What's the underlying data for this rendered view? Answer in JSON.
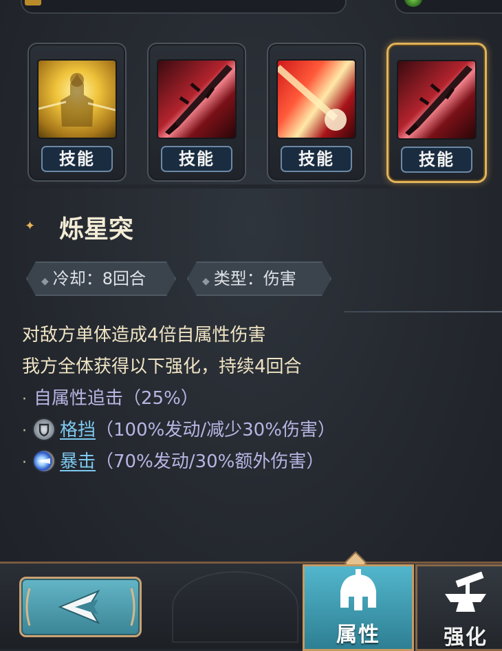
{
  "skills": [
    {
      "art": "golden-knight-skill-art",
      "tag": "技能",
      "selected": false
    },
    {
      "art": "crimson-sword-skill-art",
      "tag": "技能",
      "selected": false
    },
    {
      "art": "red-beam-skill-art",
      "tag": "技能",
      "selected": false
    },
    {
      "art": "crimson-sword-skill-art",
      "tag": "技能",
      "selected": true
    }
  ],
  "skill_detail": {
    "name": "烁星突",
    "cooldown": "冷却：8回合",
    "type": "类型：伤害",
    "description": [
      "对敌方单体造成4倍自属性伤害",
      "我方全体获得以下强化，持续4回合"
    ],
    "buffs": {
      "chase": {
        "text": "自属性追击（25%）"
      },
      "block": {
        "icon": "shield-icon",
        "link": "格挡",
        "detail": "（100%发动/减少30%伤害）"
      },
      "crit": {
        "icon": "critical-strike-icon",
        "link": "暴击",
        "detail": "（70%发动/30%额外伤害）"
      }
    },
    "bullet": "·"
  },
  "bottom_nav": {
    "back_icon": "back-arrow-icon",
    "tabs": [
      {
        "label": "属性",
        "icon": "spartan-helmet-icon",
        "active": true
      },
      {
        "label": "强化",
        "icon": "anvil-hammer-icon",
        "active": false
      }
    ]
  },
  "colors": {
    "accent_gold": "#e2b45a",
    "tag_blue": "#1a2c3f",
    "link_blue": "#7ec9ef",
    "lavender": "#b7b6e3",
    "active_tab": "#52b6cc"
  }
}
